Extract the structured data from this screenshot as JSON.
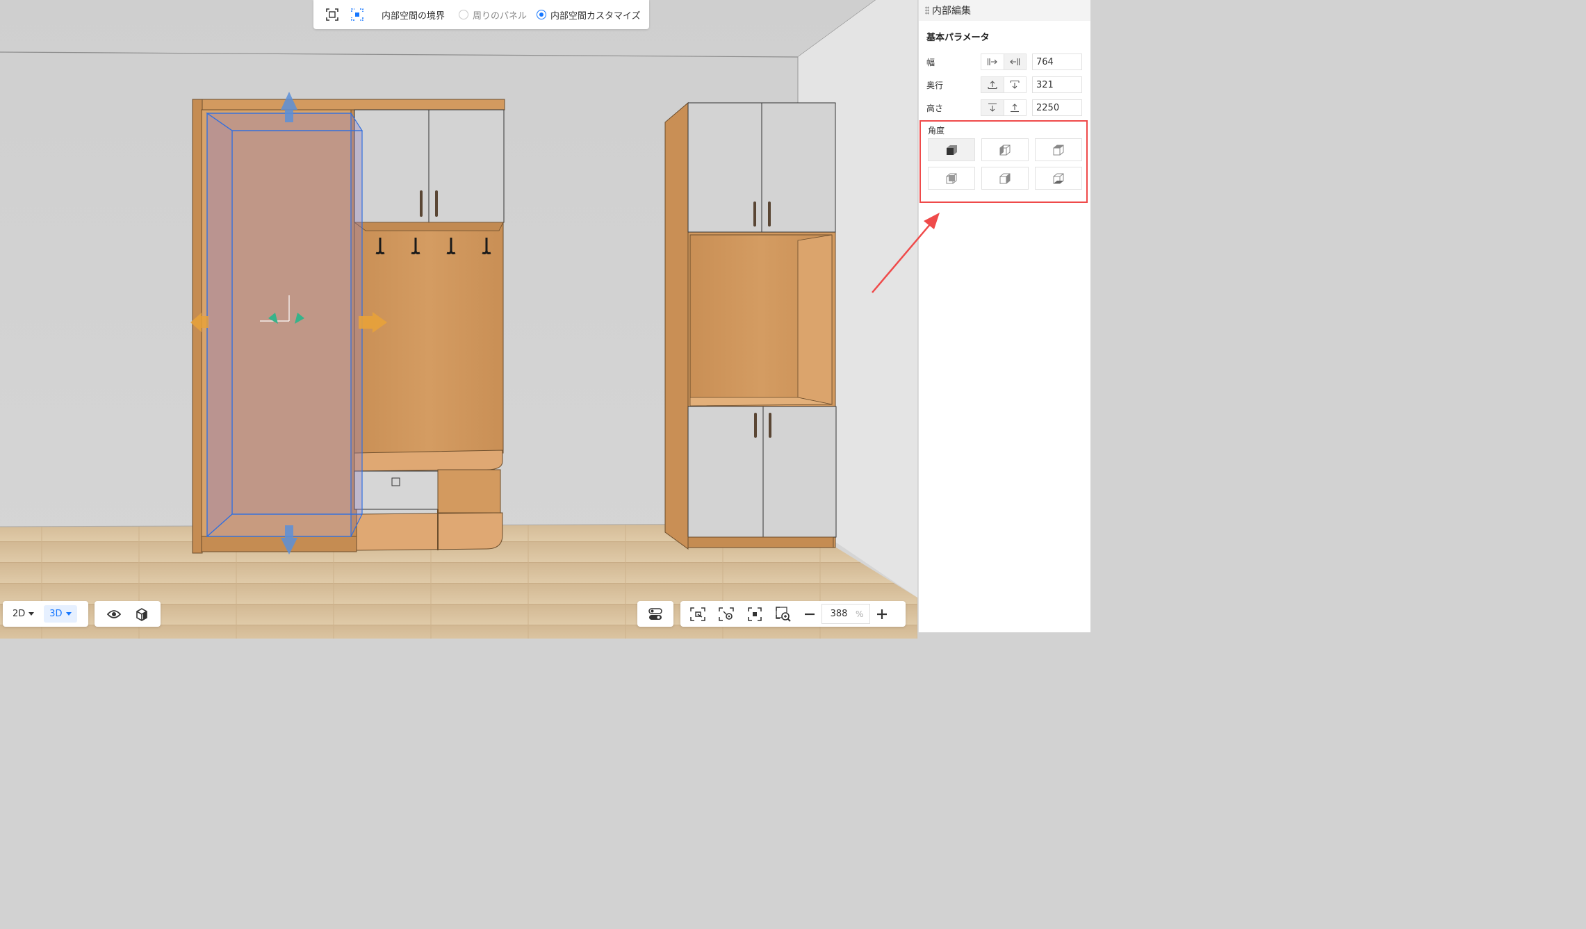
{
  "toolbar": {
    "boundary_label": "内部空間の境界",
    "radio_surrounding": "周りのパネル",
    "radio_custom": "内部空間カスタマイズ",
    "selected": "custom"
  },
  "view": {
    "mode_2d": "2D",
    "mode_3d": "3D",
    "active": "3D"
  },
  "zoom": {
    "value": "388",
    "unit": "%"
  },
  "panel": {
    "title": "内部編集",
    "section_title": "基本パラメータ",
    "params": [
      {
        "label": "幅",
        "value": "764",
        "icons": [
          "align-left-icon",
          "align-right-icon"
        ],
        "selected": 1
      },
      {
        "label": "奥行",
        "value": "321",
        "icons": [
          "align-bottom-icon",
          "align-top-icon"
        ],
        "selected": 0
      },
      {
        "label": "高さ",
        "value": "2250",
        "icons": [
          "align-top-icon",
          "align-bottom-icon"
        ],
        "selected": 0
      }
    ],
    "angle_label": "角度",
    "angle_selected": 0
  },
  "colors": {
    "accent": "#1677ff",
    "highlight_border": "#ef4a4a",
    "wood": "#d39a5f",
    "door_panel": "#d3d3d3",
    "selection_box": "#2f6fe0"
  }
}
